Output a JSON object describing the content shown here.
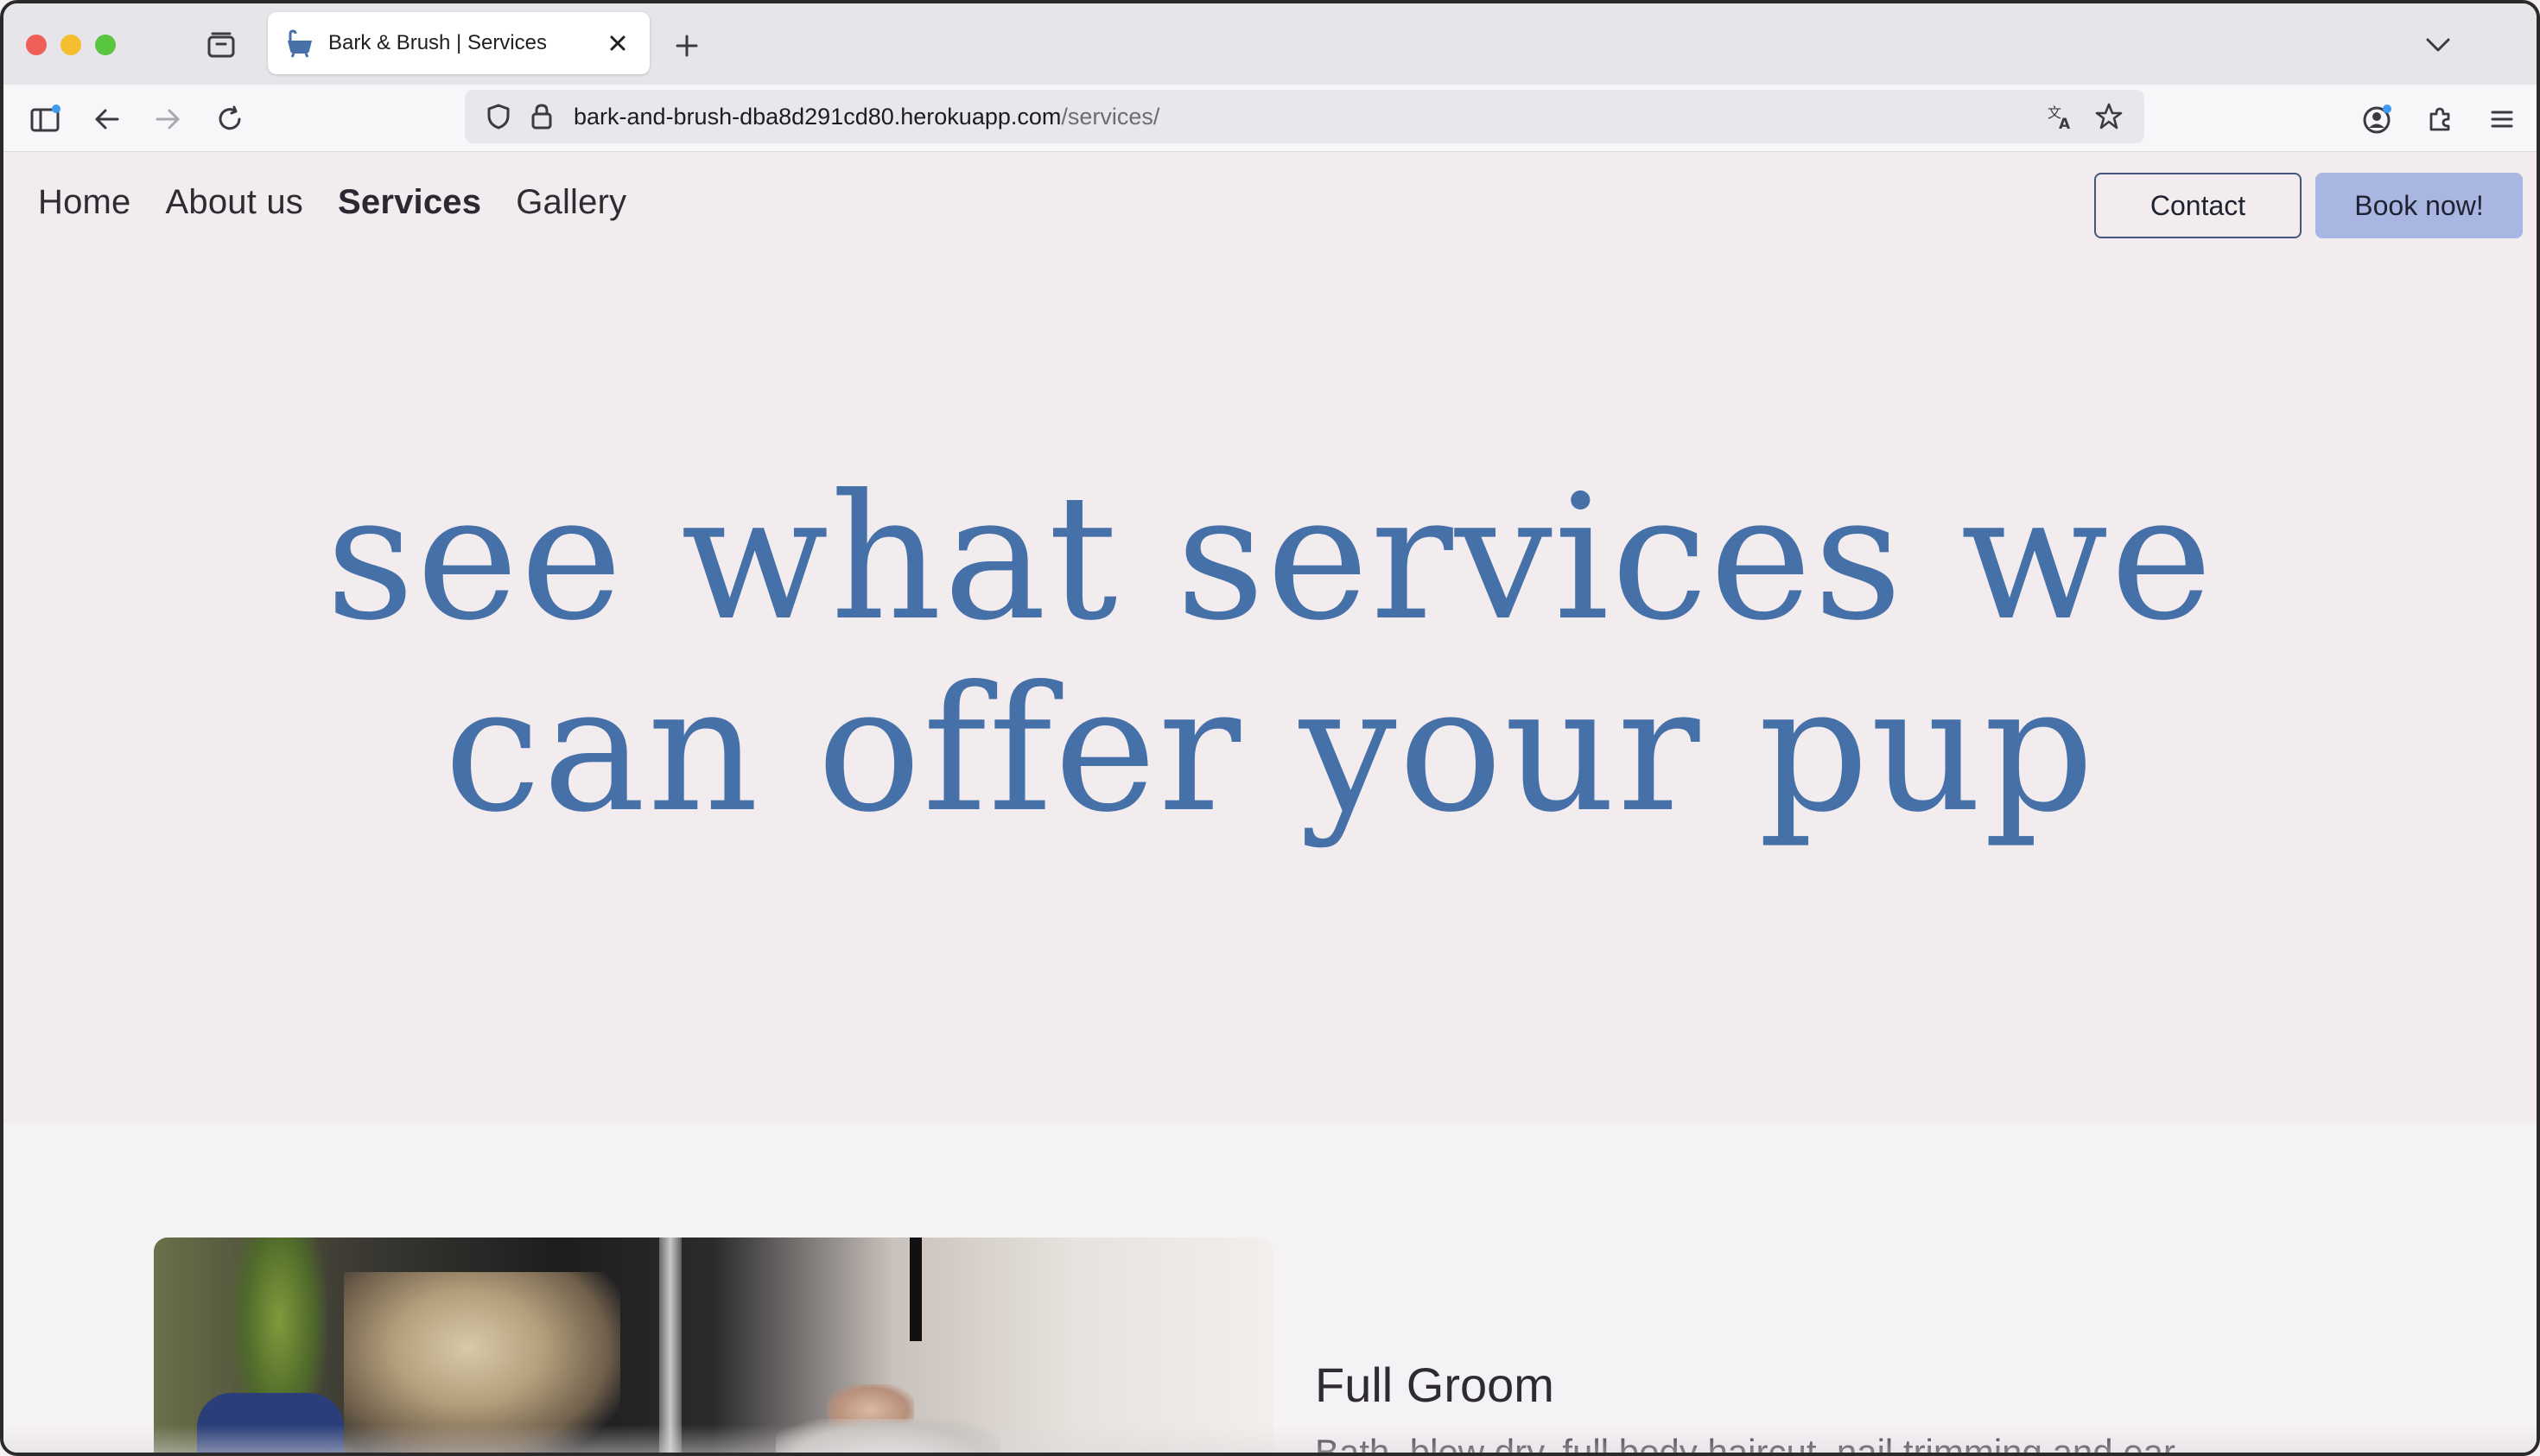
{
  "browser": {
    "tab_title": "Bark & Brush | Services",
    "url_host": "bark-and-brush-dba8d291cd80.herokuapp.com",
    "url_path": "/services/",
    "icons": {
      "sidebar": "sidebar-icon",
      "back": "back-arrow-icon",
      "forward": "forward-arrow-icon",
      "reload": "reload-icon",
      "tab_overview": "tab-overview-icon",
      "new_tab": "plus-icon",
      "tab_list": "chevron-down-icon",
      "shield": "shield-icon",
      "lock": "lock-icon",
      "translate": "translate-icon",
      "bookmark": "star-icon",
      "account": "account-icon",
      "extensions": "puzzle-icon",
      "menu": "hamburger-menu-icon"
    }
  },
  "site": {
    "nav": {
      "items": [
        {
          "label": "Home",
          "active": false
        },
        {
          "label": "About us",
          "active": false
        },
        {
          "label": "Services",
          "active": true
        },
        {
          "label": "Gallery",
          "active": false
        }
      ],
      "contact_label": "Contact",
      "book_label": "Book now!"
    },
    "hero": {
      "line1": "see what services we",
      "line2": "can offer your pup"
    },
    "service": {
      "name": "Full Groom",
      "description": "Bath, blow dry, full body haircut, nail trimming and ear"
    },
    "colors": {
      "hero_text": "#4670a8",
      "book_button": "#a9b6e2",
      "hero_bg": "#f3ecef"
    }
  }
}
